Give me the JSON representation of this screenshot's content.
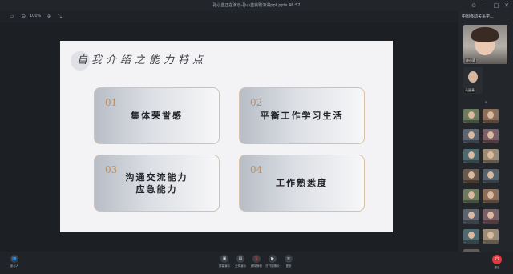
{
  "window": {
    "title": "孙小蓝正在演示-孙小蓝就职演讲ppt.pptx 46:57",
    "controls": [
      "pin-icon",
      "minimize-icon",
      "maximize-icon",
      "close-icon"
    ]
  },
  "toolbar": {
    "zoom": "100%",
    "icons": [
      "window-layout-icon",
      "zoom-out-icon",
      "zoom-in-icon",
      "fit-icon"
    ]
  },
  "slide": {
    "title": "自我介绍之能力特点",
    "cards": [
      {
        "num": "01",
        "text": "集体荣誉感"
      },
      {
        "num": "02",
        "text": "平衡工作学习生活"
      },
      {
        "num": "03",
        "text": "沟通交流能力\n应急能力"
      },
      {
        "num": "04",
        "text": "工作熟悉度"
      }
    ]
  },
  "sidebar": {
    "title": "中国移动关系学...",
    "main_participant": "孙小蓝",
    "second_participant": "马丽青",
    "thumbnails": [
      {
        "label": "..."
      },
      {
        "label": "..."
      },
      {
        "label": "..."
      },
      {
        "label": "..."
      },
      {
        "label": "..."
      },
      {
        "label": "..."
      },
      {
        "label": "..."
      },
      {
        "label": "..."
      },
      {
        "label": "..."
      },
      {
        "label": "..."
      },
      {
        "label": "..."
      },
      {
        "label": "..."
      },
      {
        "label": "..."
      },
      {
        "label": "..."
      },
      {
        "label": "..."
      }
    ]
  },
  "bottombar": {
    "participants_label": "参与人",
    "buttons": [
      {
        "icon": "screen-share-icon",
        "label": "屏幕演示"
      },
      {
        "icon": "file-present-icon",
        "label": "文件演示"
      },
      {
        "icon": "mic-icon",
        "label": "解除静音"
      },
      {
        "icon": "camera-icon",
        "label": "打开摄像头"
      },
      {
        "icon": "more-icon",
        "label": "更多"
      }
    ],
    "leave_label": "退出"
  },
  "colors": {
    "accent_gold": "#b98f63",
    "card_border": "#d8c1a6",
    "leave_red": "#e0393e"
  }
}
